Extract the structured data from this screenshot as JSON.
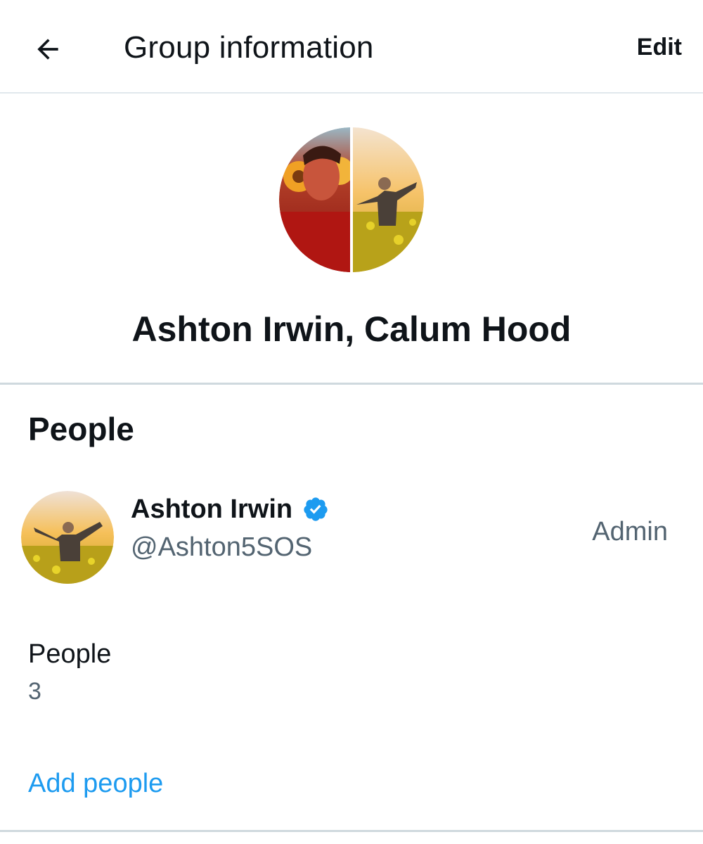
{
  "header": {
    "back_icon": "arrow-left-icon",
    "title": "Group information",
    "edit_label": "Edit"
  },
  "group": {
    "name": "Ashton Irwin, Calum Hood"
  },
  "people_section": {
    "title": "People",
    "members": [
      {
        "name": "Ashton Irwin",
        "verified": true,
        "verified_icon": "verified-badge-icon",
        "handle": "@Ashton5SOS",
        "role": "Admin"
      }
    ],
    "count_label": "People",
    "count_value": "3",
    "add_label": "Add people"
  },
  "colors": {
    "text_primary": "#0f1419",
    "text_secondary": "#536471",
    "accent": "#1d9bf0",
    "divider": "#cfd9de"
  }
}
